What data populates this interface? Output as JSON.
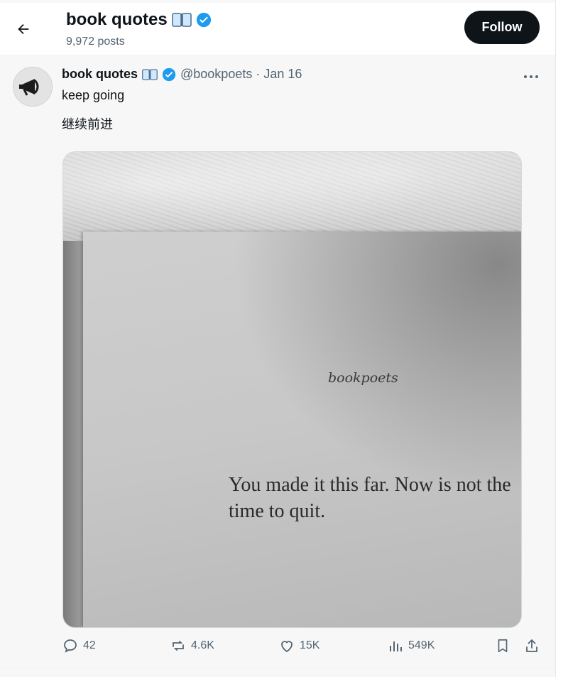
{
  "header": {
    "back_icon": "arrow-left-icon",
    "title": "book quotes",
    "posts_count": "9,972 posts",
    "follow_label": "Follow"
  },
  "tweet": {
    "author_name": "book quotes",
    "handle_date": "@bookpoets · Jan 16",
    "text_line1": "keep going",
    "text_line2": "继续前进",
    "image": {
      "brand": "bookpoets",
      "quote": "You made it this far. Now is not the time to quit."
    }
  },
  "actions": {
    "replies": "42",
    "reposts": "4.6K",
    "likes": "15K",
    "views": "549K"
  },
  "colors": {
    "accent_verified": "#1d9bf0",
    "text_secondary": "#536471",
    "follow_bg": "#0f1419"
  }
}
